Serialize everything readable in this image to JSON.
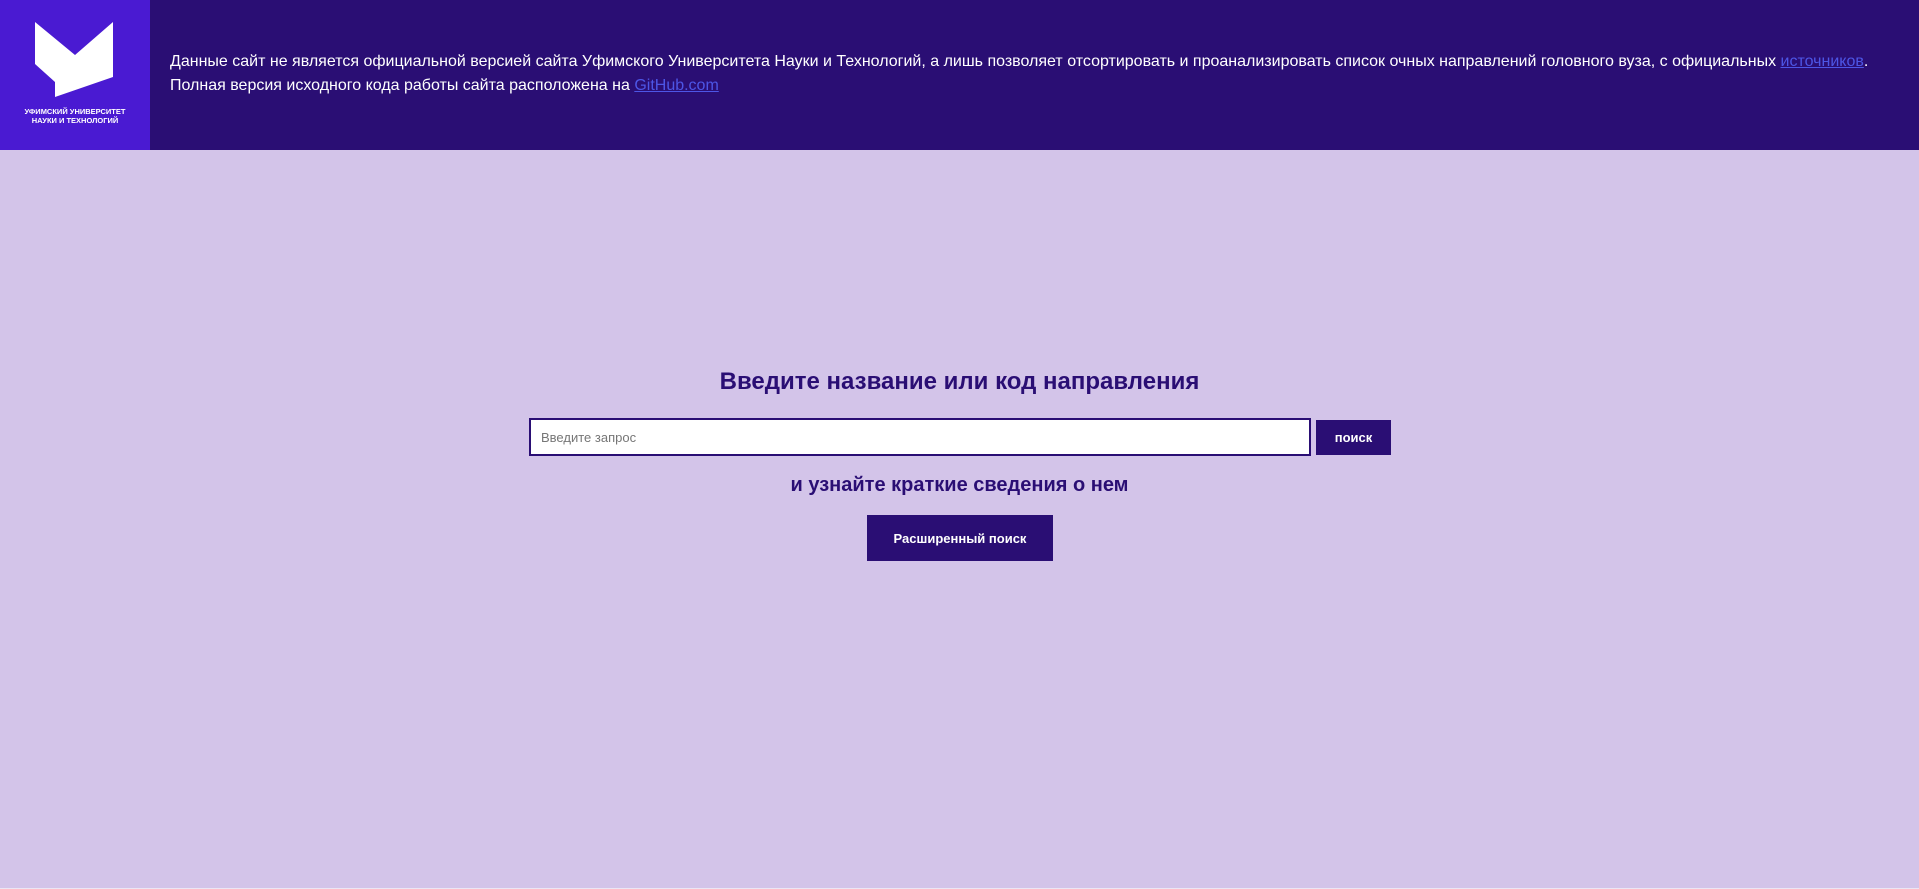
{
  "header": {
    "logo": {
      "icon": "university-logo-icon",
      "line1": "УФИМСКИЙ УНИВЕРСИТЕТ",
      "line2": "НАУКИ И ТЕХНОЛОГИЙ"
    },
    "notice": {
      "line1_text": "Данные сайт не является официальной версией сайта Уфимского Университета Науки и Технологий, а лишь позволяет отсортировать и проанализировать список очных направлений головного вуза, с официальных ",
      "line1_link": "источников",
      "line1_end": ".",
      "line2_text": "Полная версия исходного кода работы сайта расположена на ",
      "line2_link": "GitHub.com"
    }
  },
  "main": {
    "title": "Введите название или код направления",
    "search": {
      "placeholder": "Введите запрос",
      "value": "",
      "button_label": "поиск"
    },
    "subtitle": "и узнайте краткие сведения о нем",
    "advanced_search_label": "Расширенный поиск"
  },
  "colors": {
    "header_bg": "#2a0e74",
    "logo_bg": "#4a1ad2",
    "page_bg": "#d3c4e9",
    "link": "#4d56e6",
    "accent": "#2a0e74"
  }
}
